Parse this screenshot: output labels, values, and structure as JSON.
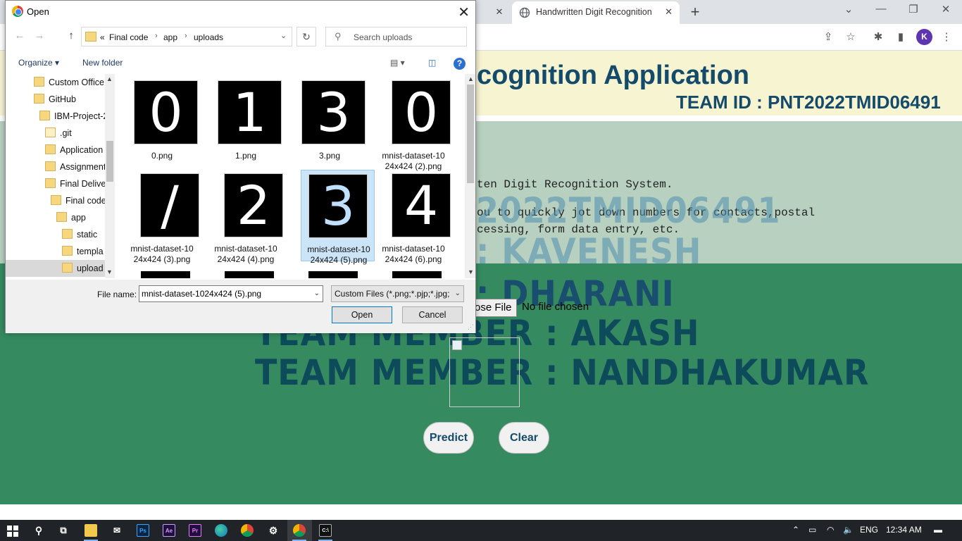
{
  "browser": {
    "active_tab_title": "Handwritten Digit Recognition",
    "avatar_initial": "K"
  },
  "page": {
    "header_title": "cognition Application",
    "team_id": "TEAM ID : PNT2022TMID06491",
    "info_line1": "ten Digit Recognition System.",
    "info_line2": "ou to quickly jot down numbers for contacts,postal",
    "info_line3": "cessing, form data entry, etc.",
    "overlay_lines": [
      "2022TMID06491",
      ": KAVENESH",
      "TEAM MEMBER : DHARANI",
      "TEAM MEMBER : AKASH",
      "TEAM MEMBER : NANDHAKUMAR"
    ],
    "choose_file_label": "ose File",
    "file_status": "No file chosen",
    "predict_label": "Predict",
    "clear_label": "Clear",
    "colors": {
      "header_bg": "#f7f4d2",
      "info_bg": "#b8d0c0",
      "green_bg": "#358a60",
      "text_dark": "#144a6a"
    }
  },
  "dialog": {
    "title": "Open",
    "breadcrumb": [
      "«",
      "Final code",
      "app",
      "uploads"
    ],
    "search_placeholder": "Search uploads",
    "organize_label": "Organize ▾",
    "new_folder_label": "New folder",
    "tree": [
      {
        "label": "Custom Office"
      },
      {
        "label": "GitHub"
      },
      {
        "label": "IBM-Project-2"
      },
      {
        "label": ".git"
      },
      {
        "label": "Application"
      },
      {
        "label": "Assignment"
      },
      {
        "label": "Final Deliver"
      },
      {
        "label": "Final code"
      },
      {
        "label": "app"
      },
      {
        "label": "static"
      },
      {
        "label": "templa"
      },
      {
        "label": "upload"
      }
    ],
    "files": [
      {
        "name_line1": "0.png",
        "name_line2": "",
        "digit": "0",
        "selected": false
      },
      {
        "name_line1": "1.png",
        "name_line2": "",
        "digit": "1",
        "selected": false
      },
      {
        "name_line1": "3.png",
        "name_line2": "",
        "digit": "3",
        "selected": false
      },
      {
        "name_line1": "mnist-dataset-10",
        "name_line2": "24x424 (2).png",
        "digit": "0",
        "selected": false
      },
      {
        "name_line1": "mnist-dataset-10",
        "name_line2": "24x424 (3).png",
        "digit": "/",
        "selected": false
      },
      {
        "name_line1": "mnist-dataset-10",
        "name_line2": "24x424 (4).png",
        "digit": "2",
        "selected": false
      },
      {
        "name_line1": "mnist-dataset-10",
        "name_line2": "24x424 (5).png",
        "digit": "3",
        "selected": true
      },
      {
        "name_line1": "mnist-dataset-10",
        "name_line2": "24x424 (6).png",
        "digit": "4",
        "selected": false
      }
    ],
    "file_name_label": "File name:",
    "file_name_value": "mnist-dataset-1024x424 (5).png",
    "filter_value": "Custom Files (*.png;*.pjp;*.jpg;",
    "open_label": "Open",
    "cancel_label": "Cancel"
  },
  "taskbar": {
    "language": "ENG",
    "time": "12:34 AM"
  }
}
